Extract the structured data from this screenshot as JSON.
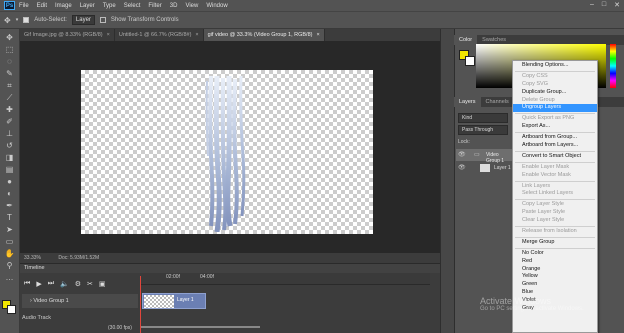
{
  "app": {
    "logo": "Ps"
  },
  "menu": [
    "File",
    "Edit",
    "Image",
    "Layer",
    "Type",
    "Select",
    "Filter",
    "3D",
    "View",
    "Window"
  ],
  "window_controls": [
    "–",
    "□",
    "✕"
  ],
  "options": {
    "auto_select": "Auto-Select:",
    "auto_select_value": "Layer",
    "show_transform": "Show Transform Controls"
  },
  "tabs": [
    {
      "label": "Gif Image.jpg @ 8.33% (RGB/8)",
      "active": false
    },
    {
      "label": "Untitled-1 @ 66.7% (RGB/8#)",
      "active": false
    },
    {
      "label": "gif video @ 33.3% (Video Group 1, RGB/8)",
      "active": true
    }
  ],
  "status": {
    "zoom": "33.33%",
    "doc": "Doc: 5.93M/1.52M"
  },
  "timeline": {
    "title": "Timeline",
    "track": "Video Group 1",
    "audio": "Audio Track",
    "clip": "Layer 1",
    "ruler": [
      "02:00f",
      "04:00f"
    ],
    "fps": "(30.00 fps)"
  },
  "panels": {
    "color_tabs": [
      "Color",
      "Swatches"
    ],
    "layer_tabs": [
      "Layers",
      "Channels"
    ],
    "kind": "Kind",
    "blend": "Pass Through",
    "lock": "Lock:",
    "layers": [
      "Video Group 1",
      "Layer 1"
    ],
    "fg_color": "#f2e600",
    "bg_color": "#ffffff"
  },
  "context_menu": [
    {
      "label": "Blending Options...",
      "disabled": false
    },
    {
      "sep": true
    },
    {
      "label": "Copy CSS",
      "disabled": true
    },
    {
      "label": "Copy SVG",
      "disabled": true
    },
    {
      "label": "Duplicate Group...",
      "disabled": false
    },
    {
      "label": "Delete Group",
      "disabled": true
    },
    {
      "label": "Ungroup Layers",
      "disabled": false,
      "highlighted": true
    },
    {
      "sep": true
    },
    {
      "label": "Quick Export as PNG",
      "disabled": true
    },
    {
      "label": "Export As...",
      "disabled": false
    },
    {
      "sep": true
    },
    {
      "label": "Artboard from Group...",
      "disabled": false
    },
    {
      "label": "Artboard from Layers...",
      "disabled": false
    },
    {
      "sep": true
    },
    {
      "label": "Convert to Smart Object",
      "disabled": false
    },
    {
      "sep": true
    },
    {
      "label": "Enable Layer Mask",
      "disabled": true
    },
    {
      "label": "Enable Vector Mask",
      "disabled": true
    },
    {
      "sep": true
    },
    {
      "label": "Link Layers",
      "disabled": true
    },
    {
      "label": "Select Linked Layers",
      "disabled": true
    },
    {
      "sep": true
    },
    {
      "label": "Copy Layer Style",
      "disabled": true
    },
    {
      "label": "Paste Layer Style",
      "disabled": true
    },
    {
      "label": "Clear Layer Style",
      "disabled": true
    },
    {
      "sep": true
    },
    {
      "label": "Release from Isolation",
      "disabled": true
    },
    {
      "sep": true
    },
    {
      "label": "Merge Group",
      "disabled": false
    },
    {
      "sep": true
    },
    {
      "label": "No Color",
      "disabled": false
    },
    {
      "label": "Red",
      "disabled": false
    },
    {
      "label": "Orange",
      "disabled": false
    },
    {
      "label": "Yellow",
      "disabled": false
    },
    {
      "label": "Green",
      "disabled": false
    },
    {
      "label": "Blue",
      "disabled": false
    },
    {
      "label": "Violet",
      "disabled": false
    },
    {
      "label": "Gray",
      "disabled": false
    }
  ],
  "watermark": {
    "title": "Activate Windows",
    "subtitle": "Go to PC settings to activate Windows."
  }
}
